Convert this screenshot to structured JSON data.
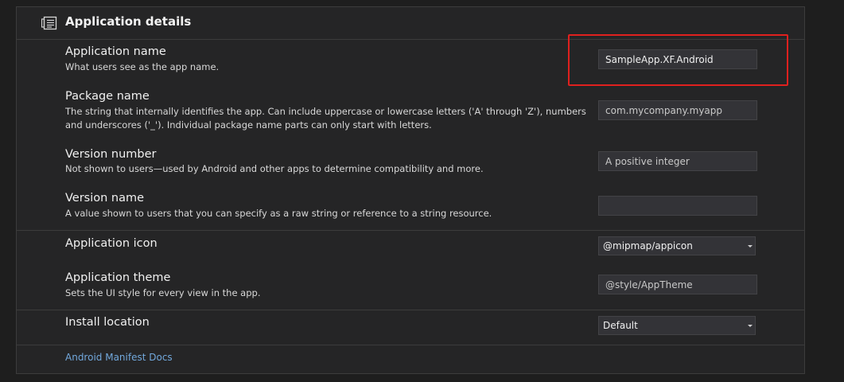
{
  "section": {
    "title": "Application details",
    "icon": "manifest-icon"
  },
  "fields": {
    "app_name": {
      "label": "Application name",
      "description": "What users see as the app name.",
      "value": "SampleApp.XF.Android"
    },
    "package_name": {
      "label": "Package name",
      "description": "The string that internally identifies the app. Can include uppercase or lowercase letters ('A' through 'Z'), numbers and underscores ('_'). Individual package name parts can only start with letters.",
      "placeholder": "com.mycompany.myapp"
    },
    "version_number": {
      "label": "Version number",
      "description": "Not shown to users—used by Android and other apps to determine compatibility and more.",
      "placeholder": "A positive integer"
    },
    "version_name": {
      "label": "Version name",
      "description": "A value shown to users that you can specify as a raw string or reference to a string resource.",
      "placeholder": ""
    },
    "app_icon": {
      "label": "Application icon",
      "selected": "@mipmap/appicon"
    },
    "app_theme": {
      "label": "Application theme",
      "description": "Sets the UI style for every view in the app.",
      "placeholder": "@style/AppTheme"
    },
    "install_location": {
      "label": "Install location",
      "selected": "Default"
    }
  },
  "links": {
    "docs": "Android Manifest Docs"
  },
  "colors": {
    "background": "#1e1e1e",
    "panel": "#252526",
    "input": "#333337",
    "link": "#72a8dc",
    "highlight": "#e0201e"
  }
}
